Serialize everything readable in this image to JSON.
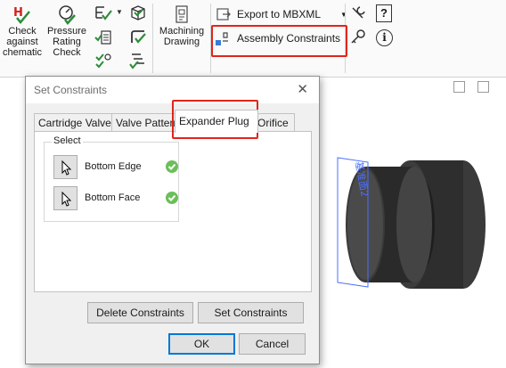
{
  "ribbon": {
    "check_schematic": [
      "Check",
      "against",
      "chematic"
    ],
    "pressure_rating": [
      "Pressure",
      "Rating",
      "Check"
    ],
    "machining_drawing": [
      "Machining",
      "Drawing"
    ],
    "export_mbxml": "Export to MBXML",
    "assembly_constraints": "Assembly Constraints"
  },
  "dialog": {
    "title": "Set Constraints",
    "tabs": [
      "Cartridge Valve",
      "Valve Pattern",
      "Expander Plug",
      "Orifice"
    ],
    "group_label": "Select",
    "selections": [
      {
        "label": "Bottom Edge"
      },
      {
        "label": "Bottom Face"
      }
    ],
    "delete_label": "Delete Constraints",
    "set_label": "Set Constraints",
    "ok_label": "OK",
    "cancel_label": "Cancel"
  },
  "colors": {
    "highlight": "#e0251b",
    "check_green": "#6bbf59",
    "model_dark": "#2b2b2b"
  }
}
